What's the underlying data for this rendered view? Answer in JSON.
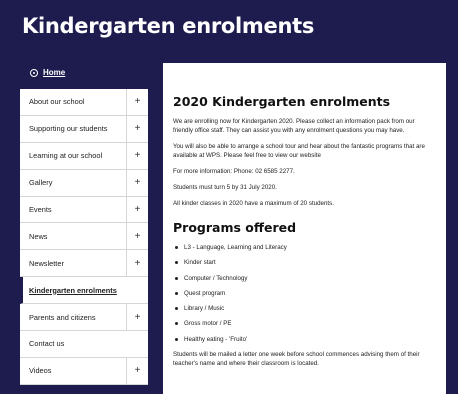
{
  "header": {
    "title": "Kindergarten enrolments"
  },
  "breadcrumb": {
    "home_label": "Home"
  },
  "sidebar": {
    "items": [
      {
        "label": "About our school",
        "expand": "+"
      },
      {
        "label": "Supporting our students",
        "expand": "+"
      },
      {
        "label": "Learning at our school",
        "expand": "+"
      },
      {
        "label": "Gallery",
        "expand": "+"
      },
      {
        "label": "Events",
        "expand": "+"
      },
      {
        "label": "News",
        "expand": "+"
      },
      {
        "label": "Newsletter",
        "expand": "+"
      },
      {
        "label": "Kindergarten enrolments",
        "expand": ""
      },
      {
        "label": "Parents and citizens",
        "expand": "+"
      },
      {
        "label": "Contact us",
        "expand": ""
      },
      {
        "label": "Videos",
        "expand": "+"
      }
    ]
  },
  "main": {
    "heading": "2020 Kindergarten enrolments",
    "paragraphs": [
      "We are enrolling now for Kindergarten 2020. Please collect an information pack from our friendly office staff. They can assist you with any enrolment questions you may have.",
      "You will also be able to arrange a school tour and hear about the fantastic programs that are available at WPS. Please feel free to view our website",
      "For more information: Phone: 02 6585 2277.",
      "Students must turn 5 by 31 July 2020.",
      "All kinder classes in 2020 have a maximum of 20 students."
    ],
    "programs_heading": "Programs offered",
    "programs": [
      "L3 - Language, Learning and Literacy",
      "Kinder start",
      "Computer / Technology",
      "Quest program",
      "Library / Music",
      "Gross motor / PE",
      "Healthy eating - 'Fruito'"
    ],
    "footer_text": "Students will be mailed a letter one week before school commences advising them of their teacher's name and where their classroom is located."
  }
}
